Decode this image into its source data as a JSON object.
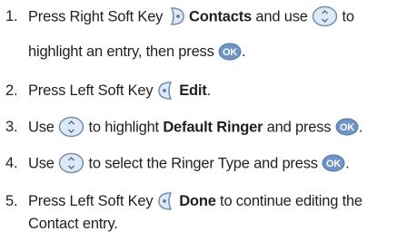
{
  "steps": [
    {
      "num": "1.",
      "line1": {
        "t1": "Press Right Soft Key ",
        "b1": "Contacts",
        "t2": " and use ",
        "t3": " to"
      },
      "line2": {
        "t1": "highlight an entry, then press ",
        "t2": "."
      },
      "icons": [
        "right-soft-key-icon",
        "navigation-key-icon",
        "ok-key-icon"
      ]
    },
    {
      "num": "2.",
      "line1": {
        "t1": "Press Left Soft Key ",
        "b1": "Edit",
        "t2": "."
      },
      "icons": [
        "left-soft-key-icon"
      ]
    },
    {
      "num": "3.",
      "line1": {
        "t1": "Use ",
        "t2": " to highlight ",
        "b1": "Default Ringer",
        "t3": " and press ",
        "t4": "."
      },
      "icons": [
        "navigation-key-icon",
        "ok-key-icon"
      ]
    },
    {
      "num": "4.",
      "line1": {
        "t1": "Use ",
        "t2": " to select the Ringer Type and press ",
        "t3": "."
      },
      "icons": [
        "navigation-key-icon",
        "ok-key-icon"
      ]
    },
    {
      "num": "5.",
      "line1": {
        "t1": "Press Left Soft Key ",
        "b1": "Done",
        "t2": " to continue editing the"
      },
      "line2": {
        "t1": "Contact entry."
      },
      "icons": [
        "left-soft-key-icon"
      ]
    }
  ],
  "colors": {
    "text": "#231f20",
    "icon_stroke": "#6e8fb4",
    "icon_fill": "#dfe9f4",
    "ok_fill": "#6f93c2",
    "ok_text": "#ffffff"
  }
}
